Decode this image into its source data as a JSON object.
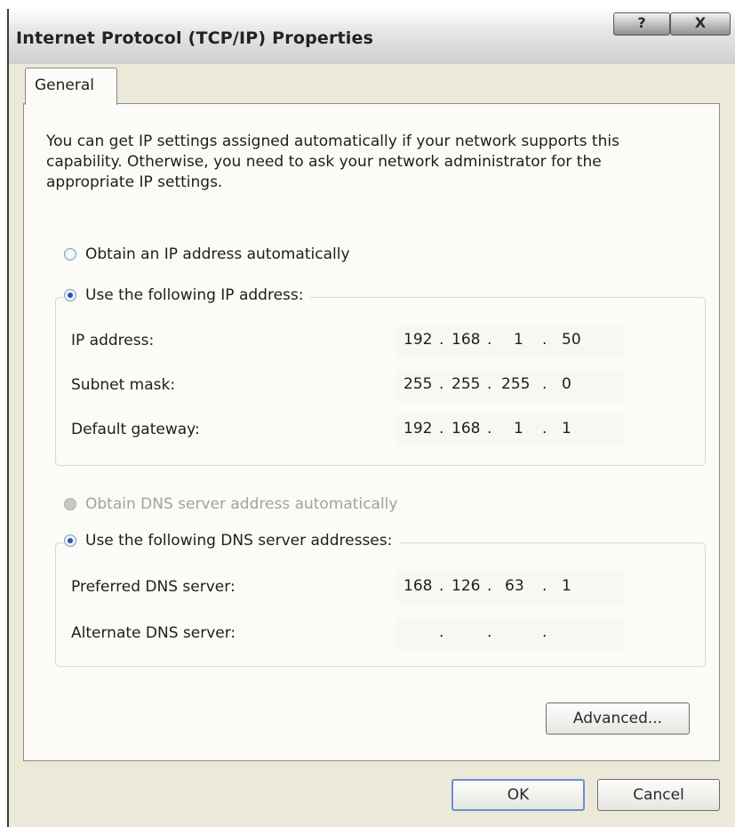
{
  "window": {
    "title": "Internet Protocol (TCP/IP) Properties",
    "help_label": "?",
    "close_label": "X"
  },
  "tabs": [
    {
      "label": "General",
      "selected": true
    }
  ],
  "intro_text": "You can get IP settings assigned automatically if your network supports this capability. Otherwise, you need to ask your network administrator for the appropriate IP settings.",
  "ip_section": {
    "auto_label": "Obtain an IP address automatically",
    "auto_selected": false,
    "manual_label": "Use the following IP address:",
    "manual_selected": true,
    "fields": [
      {
        "label": "IP address:",
        "octets": [
          "192",
          "168",
          "1",
          "50"
        ]
      },
      {
        "label": "Subnet mask:",
        "octets": [
          "255",
          "255",
          "255",
          "0"
        ]
      },
      {
        "label": "Default gateway:",
        "octets": [
          "192",
          "168",
          "1",
          "1"
        ]
      }
    ]
  },
  "dns_section": {
    "auto_label": "Obtain DNS server address automatically",
    "auto_enabled": false,
    "manual_label": "Use the following DNS server addresses:",
    "manual_selected": true,
    "fields": [
      {
        "label": "Preferred DNS server:",
        "octets": [
          "168",
          "126",
          "63",
          "1"
        ]
      },
      {
        "label": "Alternate DNS server:",
        "octets": [
          "",
          "",
          "",
          ""
        ]
      }
    ]
  },
  "ip_separator": ".",
  "buttons": {
    "advanced": "Advanced...",
    "ok": "OK",
    "cancel": "Cancel"
  },
  "colors": {
    "dialog_bg": "#ece9d8",
    "panel_bg": "#fbfbf7",
    "radio_dot": "#2c4fb8",
    "disabled_text": "#a3a39c"
  }
}
